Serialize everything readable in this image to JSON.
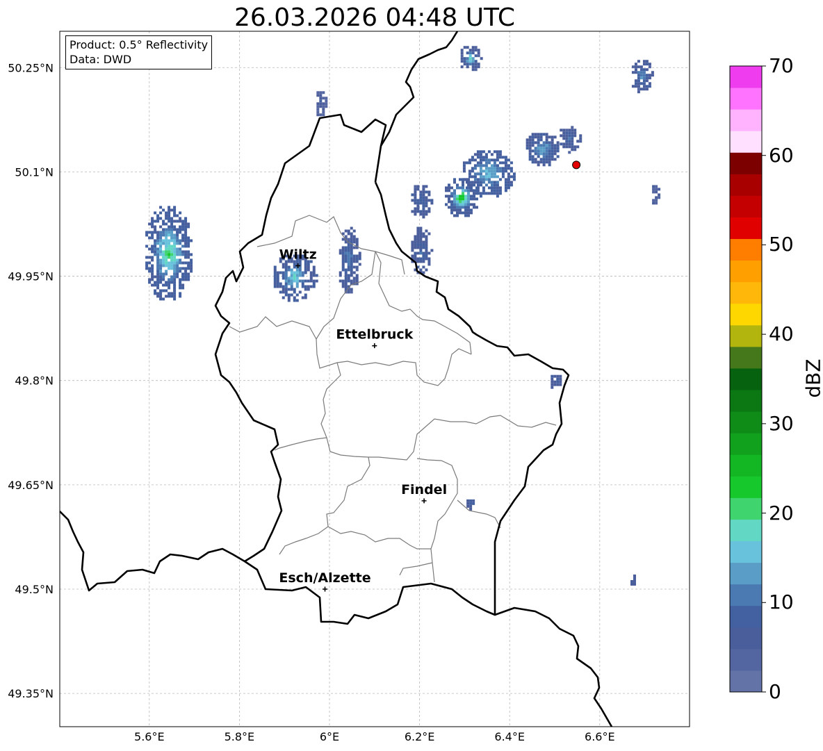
{
  "title": "26.03.2026 04:48 UTC",
  "info_box": {
    "product_line": "Product: 0.5° Reflectivity",
    "data_line": "Data: DWD"
  },
  "map_extent": {
    "lon": [
      5.4,
      6.8
    ],
    "lat": [
      49.3,
      50.3
    ]
  },
  "lat_ticks": [
    {
      "value": 50.25,
      "label": "50.25°N"
    },
    {
      "value": 50.1,
      "label": "50.1°N"
    },
    {
      "value": 49.95,
      "label": "49.95°N"
    },
    {
      "value": 49.8,
      "label": "49.8°N"
    },
    {
      "value": 49.65,
      "label": "49.65°N"
    },
    {
      "value": 49.5,
      "label": "49.5°N"
    },
    {
      "value": 49.35,
      "label": "49.35°N"
    }
  ],
  "lon_ticks": [
    {
      "value": 5.6,
      "label": "5.6°E"
    },
    {
      "value": 5.8,
      "label": "5.8°E"
    },
    {
      "value": 6.0,
      "label": "6°E"
    },
    {
      "value": 6.2,
      "label": "6.2°E"
    },
    {
      "value": 6.4,
      "label": "6.4°E"
    },
    {
      "value": 6.6,
      "label": "6.6°E"
    }
  ],
  "cities": [
    {
      "name": "Wiltz",
      "lon": 5.93,
      "lat": 49.965
    },
    {
      "name": "Ettelbruck",
      "lon": 6.1,
      "lat": 49.85
    },
    {
      "name": "Findel",
      "lon": 6.21,
      "lat": 49.627
    },
    {
      "name": "Esch/Alzette",
      "lon": 5.99,
      "lat": 49.5
    }
  ],
  "radar_site": {
    "lon": 6.548,
    "lat": 50.11,
    "color": "#e30000"
  },
  "echoes": [
    {
      "lon": 5.64,
      "lat": 49.985,
      "rlon": 0.055,
      "rlat": 0.07,
      "dbz": 8,
      "core": 22
    },
    {
      "lon": 5.92,
      "lat": 49.95,
      "rlon": 0.05,
      "rlat": 0.035,
      "dbz": 7,
      "core": 18
    },
    {
      "lon": 6.04,
      "lat": 49.975,
      "rlon": 0.025,
      "rlat": 0.05,
      "dbz": 6,
      "core": 12
    },
    {
      "lon": 6.35,
      "lat": 50.1,
      "rlon": 0.06,
      "rlat": 0.035,
      "dbz": 8,
      "core": 16
    },
    {
      "lon": 6.29,
      "lat": 50.065,
      "rlon": 0.04,
      "rlat": 0.03,
      "dbz": 7,
      "core": 26
    },
    {
      "lon": 6.2,
      "lat": 50.06,
      "rlon": 0.025,
      "rlat": 0.025,
      "dbz": 6,
      "core": 10
    },
    {
      "lon": 6.2,
      "lat": 49.99,
      "rlon": 0.025,
      "rlat": 0.035,
      "dbz": 6,
      "core": 9
    },
    {
      "lon": 6.47,
      "lat": 50.135,
      "rlon": 0.04,
      "rlat": 0.025,
      "dbz": 7,
      "core": 15
    },
    {
      "lon": 6.53,
      "lat": 50.15,
      "rlon": 0.025,
      "rlat": 0.02,
      "dbz": 6,
      "core": 9
    },
    {
      "lon": 6.69,
      "lat": 50.24,
      "rlon": 0.025,
      "rlat": 0.025,
      "dbz": 6,
      "core": 14
    },
    {
      "lon": 6.31,
      "lat": 50.265,
      "rlon": 0.025,
      "rlat": 0.02,
      "dbz": 6,
      "core": 18
    },
    {
      "lon": 5.98,
      "lat": 50.2,
      "rlon": 0.015,
      "rlat": 0.02,
      "dbz": 5,
      "core": 7
    },
    {
      "lon": 6.72,
      "lat": 50.07,
      "rlon": 0.01,
      "rlat": 0.015,
      "dbz": 5,
      "core": 6
    },
    {
      "lon": 6.5,
      "lat": 49.8,
      "rlon": 0.015,
      "rlat": 0.012,
      "dbz": 6,
      "core": 8
    },
    {
      "lon": 6.31,
      "lat": 49.625,
      "rlon": 0.012,
      "rlat": 0.008,
      "dbz": 6,
      "core": 7
    },
    {
      "lon": 6.67,
      "lat": 49.515,
      "rlon": 0.008,
      "rlat": 0.01,
      "dbz": 6,
      "core": 8
    }
  ],
  "colorbar": {
    "label": "dBZ",
    "min": 0,
    "max": 70,
    "ticks": [
      {
        "value": 0,
        "label": "0"
      },
      {
        "value": 10,
        "label": "10"
      },
      {
        "value": 20,
        "label": "20"
      },
      {
        "value": 30,
        "label": "30"
      },
      {
        "value": 40,
        "label": "40"
      },
      {
        "value": 50,
        "label": "50"
      },
      {
        "value": 60,
        "label": "60"
      },
      {
        "value": 70,
        "label": "70"
      }
    ],
    "colors": [
      "#6373a7",
      "#5466a1",
      "#4b5e9c",
      "#4360a0",
      "#4b79b2",
      "#5a9ec8",
      "#68c2dc",
      "#62d8c4",
      "#40d46f",
      "#16c82c",
      "#13b723",
      "#11a11d",
      "#0f8c18",
      "#0b7813",
      "#07620f",
      "#44781a",
      "#b3b50f",
      "#ffd700",
      "#ffb80a",
      "#ffa000",
      "#ff7e00",
      "#e00000",
      "#c40000",
      "#a80000",
      "#7d0000",
      "#ffe0ff",
      "#ffb3ff",
      "#ff73ff",
      "#ee3cee"
    ]
  }
}
